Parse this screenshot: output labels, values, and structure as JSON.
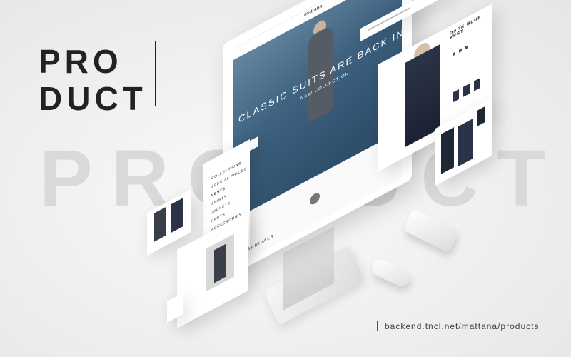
{
  "headline": {
    "line1": "PRO",
    "line2": "DUCT"
  },
  "watermark": "PRODUCT",
  "footer": {
    "url": "backend.tncl.net/mattana/products"
  },
  "monitor": {
    "brand": "mattana",
    "hero_text": "CLASSIC SUITS ARE BACK IN TOWN",
    "hero_sub": "NEW COLLECTION",
    "section_label": "NEW ARRIVALS"
  },
  "product_page": {
    "product_name": "DARK BLUE VEST"
  },
  "menu": {
    "items": [
      {
        "label": "COLLECTIONS",
        "bold": false
      },
      {
        "label": "SPECIAL PRICES",
        "bold": false
      },
      {
        "label": "VESTS",
        "bold": true
      },
      {
        "label": "SHIRTS",
        "bold": false
      },
      {
        "label": "JACKETS",
        "bold": false
      },
      {
        "label": "PANTS",
        "bold": false
      },
      {
        "label": "ACCESSORIES",
        "bold": false
      }
    ]
  },
  "colors": {
    "background": "#f1f1f1",
    "title": "#222222",
    "watermark": "#d9d9d9",
    "screen_sea": "#3e6280"
  }
}
